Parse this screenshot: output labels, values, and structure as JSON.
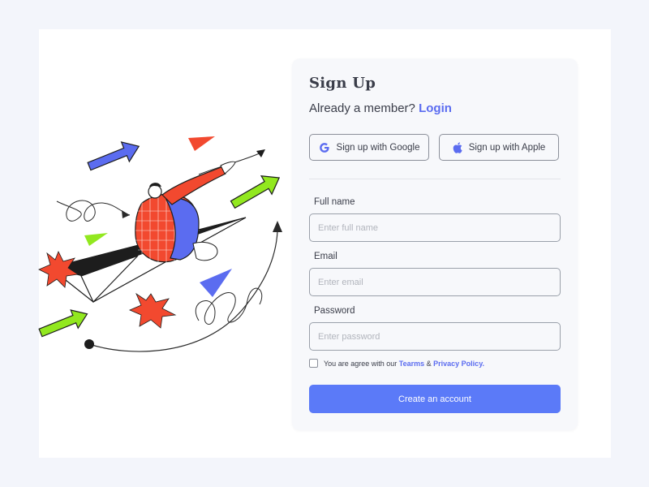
{
  "signup": {
    "title": "Sign Up",
    "member_prompt": "Already a member?",
    "login_link": "Login",
    "google_button": "Sign up with Google",
    "apple_button": "Sign up with Apple",
    "fields": [
      {
        "label": "Full name",
        "placeholder": "Enter full name",
        "value": ""
      },
      {
        "label": "Email",
        "placeholder": "Enter email",
        "value": ""
      },
      {
        "label": "Password",
        "placeholder": "Enter password",
        "value": ""
      }
    ],
    "agree_text": "You are agree with our",
    "terms_link": "Tearms",
    "ampersand": "&",
    "privacy_link": "Privacy Policy.",
    "submit_button": "Create an account"
  },
  "colors": {
    "accent": "#5b7af8",
    "link": "#5b6cf0",
    "illustration_red": "#f2492f",
    "illustration_blue": "#5b6cf0",
    "illustration_green": "#92e81f"
  },
  "icons": {
    "google": "google-icon",
    "apple": "apple-icon"
  }
}
